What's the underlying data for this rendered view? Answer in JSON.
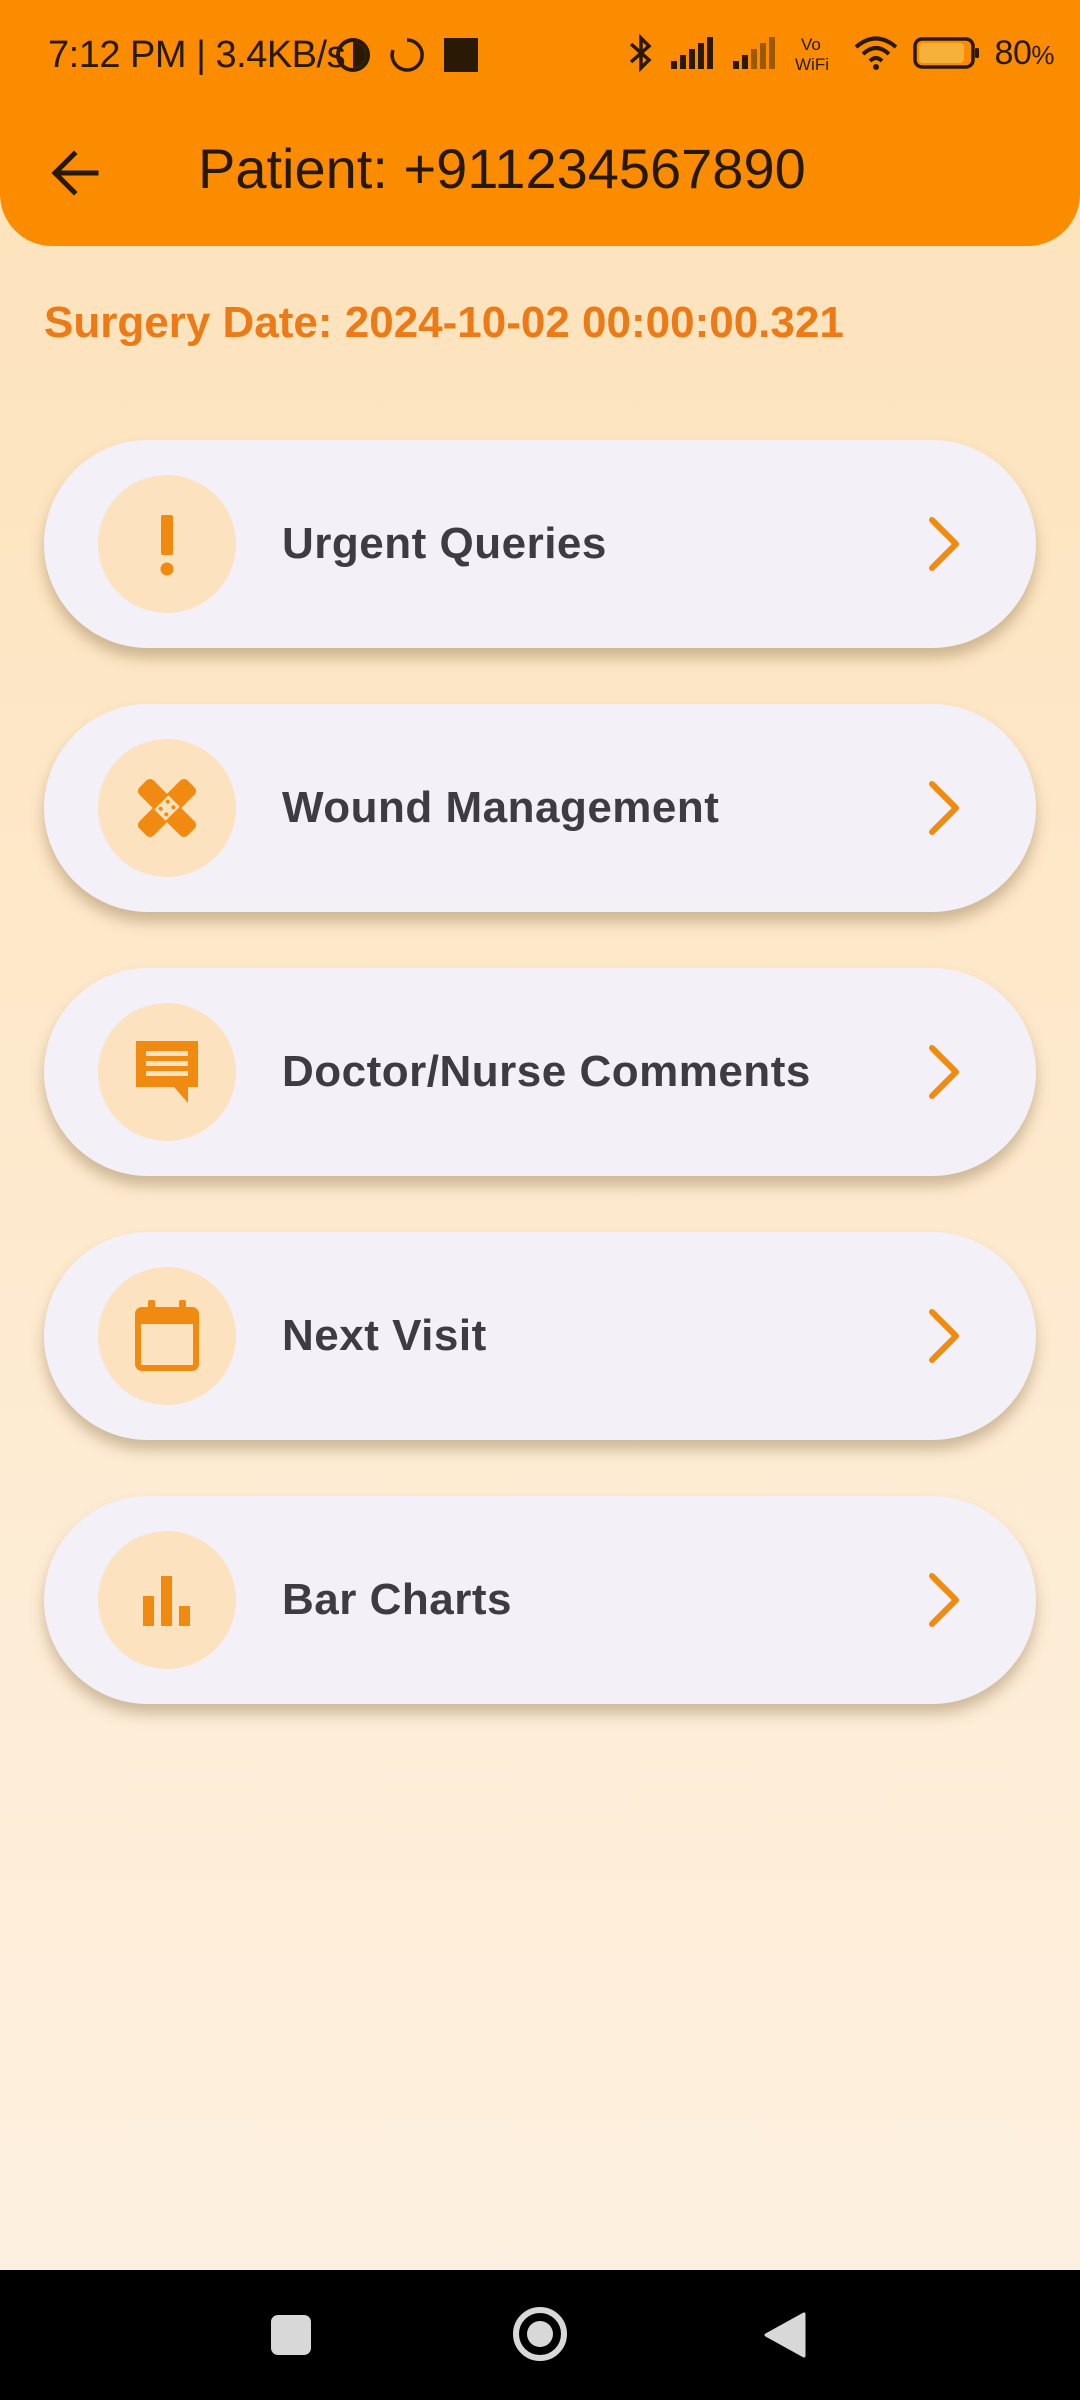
{
  "status_bar": {
    "time_speed": "7:12 PM | 3.4KB/s",
    "network_label_top": "Vo",
    "network_label_bottom": "WiFi",
    "battery": "80",
    "battery_unit": "%"
  },
  "header": {
    "title": "Patient: +911234567890",
    "back_icon": "arrow-back-icon"
  },
  "surgery_date": "Surgery Date: 2024-10-02 00:00:00.321",
  "menu": [
    {
      "label": "Urgent Queries",
      "icon": "exclamation-icon"
    },
    {
      "label": "Wound Management",
      "icon": "bandage-icon"
    },
    {
      "label": "Doctor/Nurse Comments",
      "icon": "comment-icon"
    },
    {
      "label": "Next Visit",
      "icon": "calendar-icon"
    },
    {
      "label": "Bar Charts",
      "icon": "bar-chart-icon"
    }
  ],
  "colors": {
    "header": "#fb8c00",
    "accent": "#f08a10",
    "date_text": "#ec7a16",
    "card": "#f4f0f8",
    "icon_bg": "#fde2c0"
  },
  "nav_bar": [
    "recents-icon",
    "home-icon",
    "back-icon"
  ]
}
